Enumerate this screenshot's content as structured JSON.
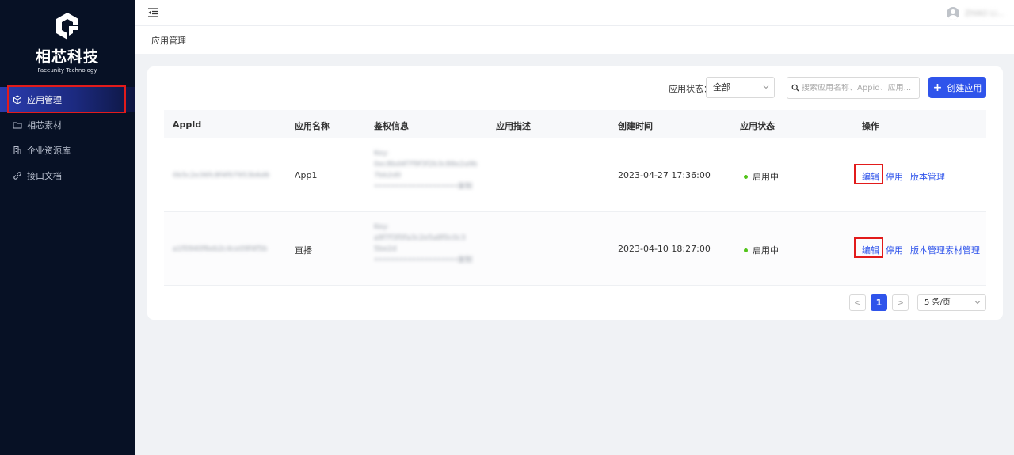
{
  "brand": {
    "name": "相芯科技",
    "subtitle": "Faceunity Technology"
  },
  "sidebar": {
    "items": [
      {
        "label": "应用管理",
        "icon": "cube-icon",
        "active": true
      },
      {
        "label": "相芯素材",
        "icon": "folder-icon",
        "active": false
      },
      {
        "label": "企业资源库",
        "icon": "building-icon",
        "active": false
      },
      {
        "label": "接口文档",
        "icon": "link-icon",
        "active": false
      }
    ]
  },
  "topbar": {
    "username": "ZHAO Li..."
  },
  "breadcrumb": "应用管理",
  "toolbar": {
    "status_label": "应用状态：",
    "status_value": "全部",
    "search_placeholder": "搜索应用名称、Appid、应用...",
    "create_label": "创建应用"
  },
  "table": {
    "columns": [
      "AppId",
      "应用名称",
      "鉴权信息",
      "应用描述",
      "创建时间",
      "应用状态",
      "操作"
    ],
    "rows": [
      {
        "appid": "0b5c2e36fc8f4f07953b6d6",
        "name": "App1",
        "auth_lines": [
          "Key:",
          "0ec8bd4f7f9f3f2b3c88e2a9b",
          "7bb2d0",
          "••••••••••••••••••••复制"
        ],
        "description": "",
        "created": "2023-04-27 17:36:00",
        "status": "启用中",
        "actions": [
          "编辑",
          "停用",
          "版本管理"
        ]
      },
      {
        "appid": "a1f0940f6eb2c4ce09f4f5b",
        "name": "直播",
        "auth_lines": [
          "Key:",
          "a9f7f3f0fa3c2e5a8f0c0c3",
          "5be2d",
          "••••••••••••••••••••复制"
        ],
        "description": "",
        "created": "2023-04-10 18:27:00",
        "status": "启用中",
        "actions": [
          "编辑",
          "停用",
          "版本管理",
          "素材管理"
        ]
      }
    ]
  },
  "pagination": {
    "prev": "<",
    "current": "1",
    "next": ">",
    "page_size": "5 条/页"
  },
  "colors": {
    "sidebar_bg": "#071125",
    "accent": "#2f54eb",
    "status_active": "#52c41a",
    "highlight": "#e21b1b"
  }
}
